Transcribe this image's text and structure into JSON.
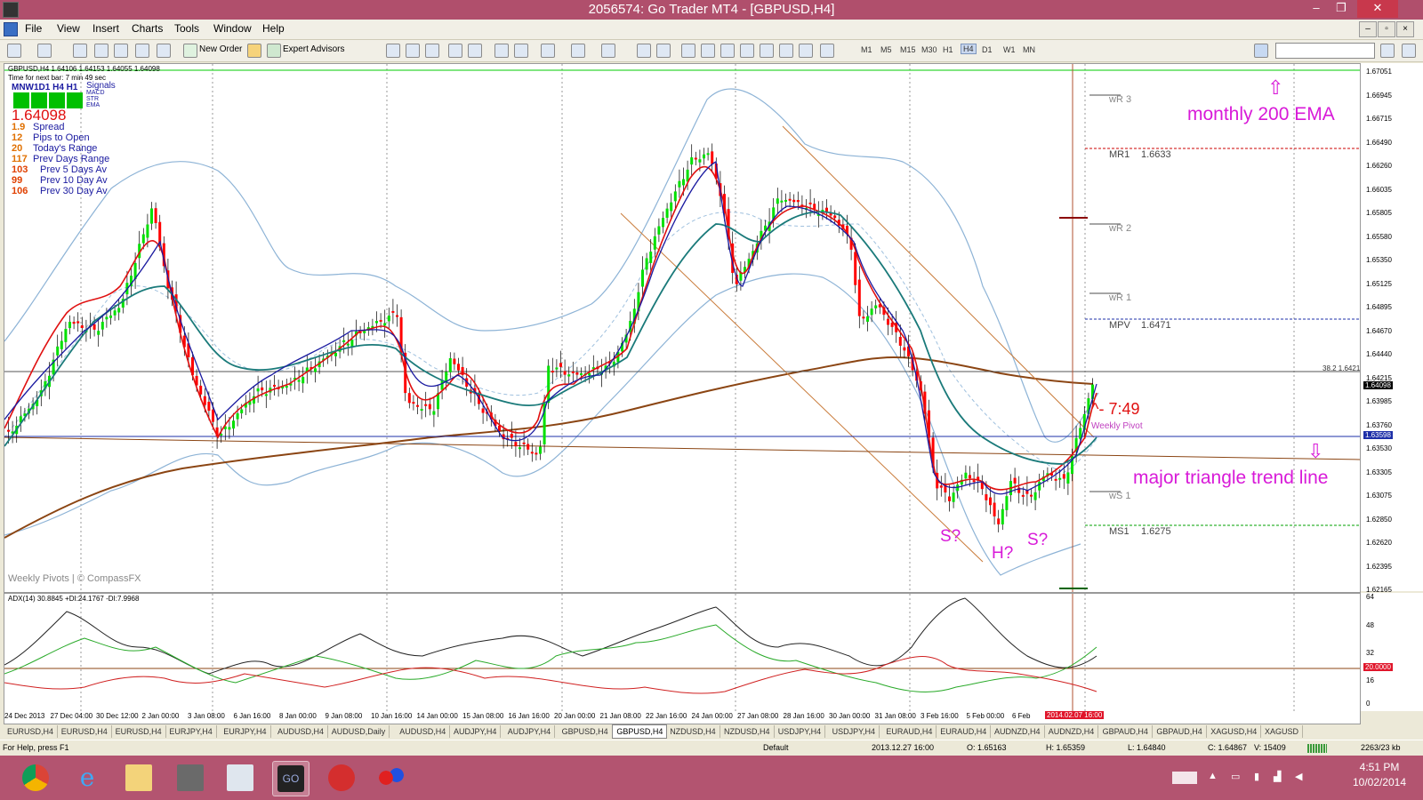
{
  "window": {
    "title": "2056574: Go Trader MT4 - [GBPUSD,H4]",
    "controls": [
      "–",
      "❐",
      "✕"
    ]
  },
  "menu": [
    "File",
    "View",
    "Insert",
    "Charts",
    "Tools",
    "Window",
    "Help"
  ],
  "mdi_controls": [
    "–",
    "▫",
    "×"
  ],
  "toolbar": {
    "new_order": "New Order",
    "expert_advisors": "Expert Advisors",
    "timeframes": [
      "M1",
      "M5",
      "M15",
      "M30",
      "H1",
      "H4",
      "D1",
      "W1",
      "MN"
    ],
    "active_timeframe": "H4"
  },
  "chart_header": {
    "symbol_line": "GBPUSD,H4 1.64106 1.64153 1.64055 1.64098",
    "next_bar": "Time for next bar: 7 min 49 sec",
    "signals_label": "MNW1D1 H4 H1",
    "signals_title": "Signals",
    "signal_rows": [
      "MACD",
      "STR",
      "EMA"
    ],
    "price": "1.64098",
    "stats": [
      {
        "value": "1.9",
        "label": "Spread"
      },
      {
        "value": "12",
        "label": "Pips to Open"
      },
      {
        "value": "20",
        "label": "Today's Range"
      },
      {
        "value": "117",
        "label": "Prev Days Range"
      },
      {
        "value": "103",
        "label": "Prev 5 Days Av"
      },
      {
        "value": "99",
        "label": "Prev 10 Day Av"
      },
      {
        "value": "106",
        "label": "Prev 30 Day Av"
      }
    ],
    "watermark": "Weekly Pivots | © CompassFX"
  },
  "pivots": {
    "wr3": "wR 3",
    "mr1": "MR1",
    "mr1_value": "1.6633",
    "wr2": "wR 2",
    "wr1": "wR 1",
    "mpv": "MPV",
    "mpv_value": "1.6471",
    "weekly_pivot": "Weekly Pivot",
    "ws1": "wS 1",
    "ms1": "MS1",
    "ms1_value": "1.6275",
    "fib": "38.2 1.64210"
  },
  "annotations": {
    "monthly_ema": "monthly 200 EMA",
    "triangle": "major triangle trend line",
    "countdown": "^- 7:49",
    "s1": "S?",
    "h": "H?",
    "s2": "S?",
    "up_arrow": "⇧",
    "down_arrow": "⇩"
  },
  "indicator": {
    "label": "ADX(14) 30.8845 +DI:24.1767 -DI:7.9968",
    "yticks": [
      "64",
      "48",
      "32",
      "16",
      "0"
    ],
    "level_tag": "20.0000"
  },
  "price_axis": {
    "ticks": [
      "1.67051",
      "1.66945",
      "1.66715",
      "1.66490",
      "1.66260",
      "1.66035",
      "1.65805",
      "1.65580",
      "1.65350",
      "1.65125",
      "1.64895",
      "1.64670",
      "1.64440",
      "1.64215",
      "1.63985",
      "1.63760",
      "1.63530",
      "1.63305",
      "1.63075",
      "1.62850",
      "1.62620",
      "1.62395",
      "1.62165"
    ],
    "current_tag": "1.64098",
    "pivot_tag": "1.63598"
  },
  "time_axis": {
    "ticks": [
      "24 Dec 2013",
      "27 Dec 04:00",
      "30 Dec 12:00",
      "2 Jan 00:00",
      "3 Jan 08:00",
      "6 Jan 16:00",
      "8 Jan 00:00",
      "9 Jan 08:00",
      "10 Jan 16:00",
      "14 Jan 00:00",
      "15 Jan 08:00",
      "16 Jan 16:00",
      "20 Jan 00:00",
      "21 Jan 08:00",
      "22 Jan 16:00",
      "24 Jan 00:00",
      "27 Jan 08:00",
      "28 Jan 16:00",
      "30 Jan 00:00",
      "31 Jan 08:00",
      "3 Feb 16:00",
      "5 Feb 00:00",
      "6 Feb"
    ],
    "current_marker": "2014.02.07 16:00"
  },
  "tabs": [
    "EURUSD,H4",
    "EURUSD,H4",
    "EURUSD,H4",
    "EURJPY,H4",
    "EURJPY,H4",
    "AUDUSD,H4",
    "AUDUSD,Daily",
    "AUDUSD,H4",
    "AUDJPY,H4",
    "AUDJPY,H4",
    "GBPUSD,H4",
    "GBPUSD,H4",
    "NZDUSD,H4",
    "NZDUSD,H4",
    "USDJPY,H4",
    "USDJPY,H4",
    "EURAUD,H4",
    "EURAUD,H4",
    "AUDNZD,H4",
    "AUDNZD,H4",
    "GBPAUD,H4",
    "GBPAUD,H4",
    "XAGUSD,H4",
    "XAGUSD"
  ],
  "active_tab_index": 11,
  "status": {
    "help": "For Help, press F1",
    "profile": "Default",
    "time": "2013.12.27 16:00",
    "open": "O: 1.65163",
    "high": "H: 1.65359",
    "low": "L: 1.64840",
    "close": "C: 1.64867",
    "volume": "V: 15409",
    "traffic": "2263/23 kb"
  },
  "taskbar": {
    "time": "4:51 PM",
    "date": "10/02/2014"
  },
  "colors": {
    "titlebar": "#b04f6c",
    "taskbar": "#b35470",
    "bull_candle": "#00e000",
    "bear_candle": "#ff0000",
    "annotation": "#d81ad8",
    "ema200": "#8b4513"
  }
}
